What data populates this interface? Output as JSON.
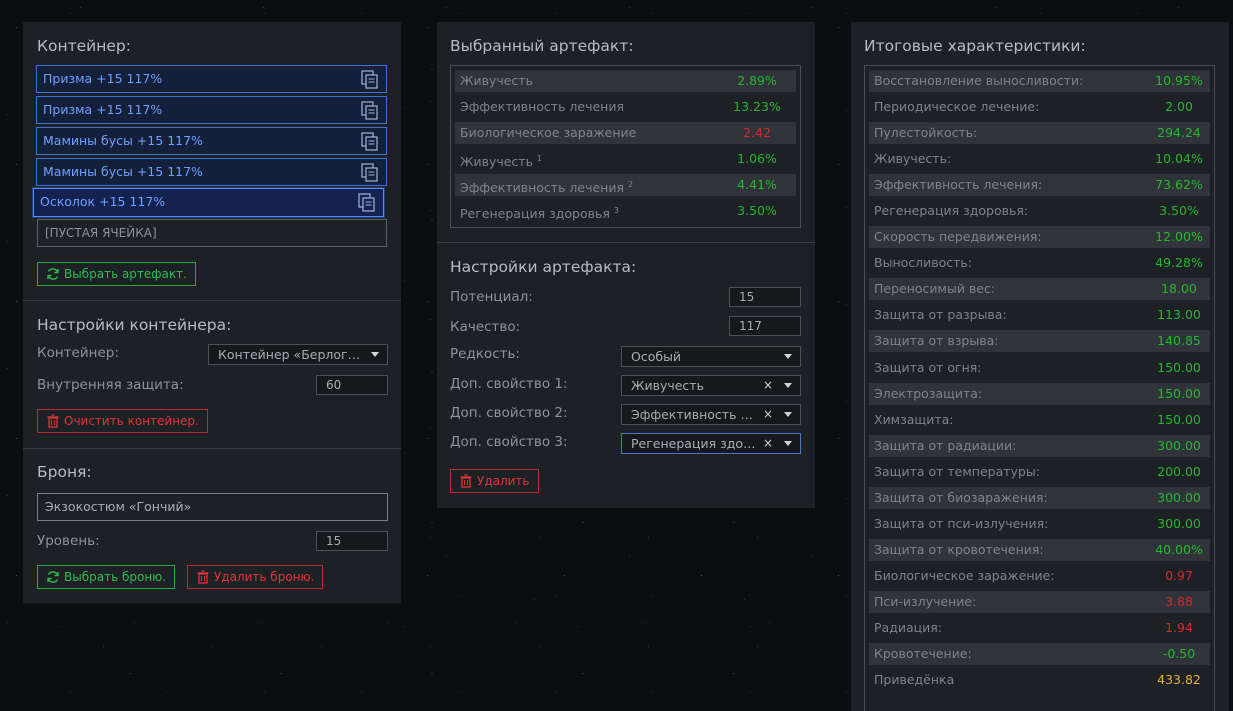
{
  "container_panel": {
    "title": "Контейнер:",
    "slots": [
      {
        "label": "Призма +15 117%"
      },
      {
        "label": "Призма +15 117%"
      },
      {
        "label": "Мамины бусы +15 117%"
      },
      {
        "label": "Мамины бусы +15 117%"
      },
      {
        "label": "Осколок +15 117%"
      }
    ],
    "empty_slot_label": "[ПУСТАЯ ЯЧЕЙКА]",
    "select_artifact_button": "Выбрать артефакт."
  },
  "container_settings": {
    "title": "Настройки контейнера:",
    "container_label": "Контейнер:",
    "container_value": "Контейнер «Берлога…",
    "inner_protection_label": "Внутренняя защита:",
    "inner_protection_value": "60",
    "clear_button": "Очистить контейнер."
  },
  "armor": {
    "title": "Броня:",
    "armor_value": "Экзокостюм «Гончий»",
    "level_label": "Уровень:",
    "level_value": "15",
    "select_button": "Выбрать броню.",
    "delete_button": "Удалить броню."
  },
  "selected_artifact": {
    "title": "Выбранный артефакт:",
    "stats": [
      {
        "name": "Живучесть",
        "sup": "",
        "value": "2.89%",
        "tone": "pos"
      },
      {
        "name": "Эффективность лечения",
        "sup": "",
        "value": "13.23%",
        "tone": "pos"
      },
      {
        "name": "Биологическое заражение",
        "sup": "",
        "value": "2.42",
        "tone": "neg"
      },
      {
        "name": "Живучесть",
        "sup": "1",
        "value": "1.06%",
        "tone": "pos"
      },
      {
        "name": "Эффективность лечения",
        "sup": "2",
        "value": "4.41%",
        "tone": "pos"
      },
      {
        "name": "Регенерация здоровья",
        "sup": "3",
        "value": "3.50%",
        "tone": "pos"
      }
    ]
  },
  "artifact_settings": {
    "title": "Настройки артефакта:",
    "potential_label": "Потенциал:",
    "potential_value": "15",
    "quality_label": "Качество:",
    "quality_value": "117",
    "rarity_label": "Редкость:",
    "rarity_value": "Особый",
    "extra1_label": "Доп. свойство 1:",
    "extra1_value": "Живучесть",
    "extra2_label": "Доп. свойство 2:",
    "extra2_value": "Эффективность ле…",
    "extra3_label": "Доп. свойство 3:",
    "extra3_value": "Регенерация здор…",
    "clear_symbol": "×",
    "delete_button": "Удалить"
  },
  "totals": {
    "title": "Итоговые характеристики:",
    "stats": [
      {
        "name": "Восстановление выносливости:",
        "value": "10.95%",
        "tone": "pos"
      },
      {
        "name": "Периодическое лечение:",
        "value": "2.00",
        "tone": "pos"
      },
      {
        "name": "Пулестойкость:",
        "value": "294.24",
        "tone": "pos"
      },
      {
        "name": "Живучесть:",
        "value": "10.04%",
        "tone": "pos"
      },
      {
        "name": "Эффективность лечения:",
        "value": "73.62%",
        "tone": "pos"
      },
      {
        "name": "Регенерация здоровья:",
        "value": "3.50%",
        "tone": "pos"
      },
      {
        "name": "Скорость передвижения:",
        "value": "12.00%",
        "tone": "pos"
      },
      {
        "name": "Выносливость:",
        "value": "49.28%",
        "tone": "pos"
      },
      {
        "name": "Переносимый вес:",
        "value": "18.00",
        "tone": "pos"
      },
      {
        "name": "Защита от разрыва:",
        "value": "113.00",
        "tone": "pos"
      },
      {
        "name": "Защита от взрыва:",
        "value": "140.85",
        "tone": "pos"
      },
      {
        "name": "Защита от огня:",
        "value": "150.00",
        "tone": "pos"
      },
      {
        "name": "Электрозащита:",
        "value": "150.00",
        "tone": "pos"
      },
      {
        "name": "Химзащита:",
        "value": "150.00",
        "tone": "pos"
      },
      {
        "name": "Защита от радиации:",
        "value": "300.00",
        "tone": "pos"
      },
      {
        "name": "Защита от температуры:",
        "value": "200.00",
        "tone": "pos"
      },
      {
        "name": "Защита от биозаражения:",
        "value": "300.00",
        "tone": "pos"
      },
      {
        "name": "Защита от пси-излучения:",
        "value": "300.00",
        "tone": "pos"
      },
      {
        "name": "Защита от кровотечения:",
        "value": "40.00%",
        "tone": "pos"
      },
      {
        "name": "Биологическое заражение:",
        "value": "0.97",
        "tone": "neg"
      },
      {
        "name": "Пси-излучение:",
        "value": "3.88",
        "tone": "neg"
      },
      {
        "name": "Радиация:",
        "value": "1.94",
        "tone": "neg"
      },
      {
        "name": "Кровотечение:",
        "value": "-0.50",
        "tone": "pos"
      },
      {
        "name": "Приведёнка",
        "value": "433.82",
        "tone": "gold"
      }
    ]
  },
  "colors": {
    "positive": "#28b530",
    "negative": "#d32a2a",
    "highlight": "#e8b030",
    "accent": "#3b74d6"
  },
  "icons": {
    "slot": "copy-icon",
    "select": "refresh-icon",
    "delete": "trash-icon"
  }
}
